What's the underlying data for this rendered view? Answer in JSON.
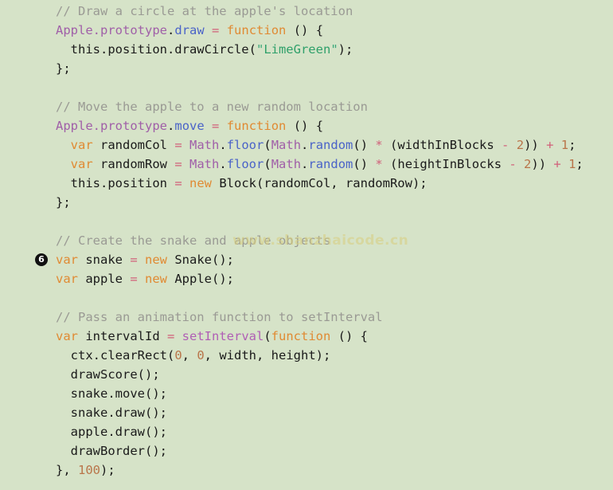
{
  "editor": {
    "background_color": "#d6e3c8",
    "font_size_px": 15.5,
    "line_height_px": 24,
    "language": "JavaScript"
  },
  "watermark": {
    "text": "www.shanzhaicode.cn",
    "color": "#d8cf7e"
  },
  "step_marker": {
    "label": "6",
    "line_index": 12,
    "background_color": "#111111",
    "text_color": "#ffffff"
  },
  "palette": {
    "comment": "#9a9a94",
    "class": "#a05fa8",
    "property": "#4a63c8",
    "operator": "#d1607a",
    "keyword": "#e08a33",
    "string": "#2fa06a",
    "function": "#b05fb5",
    "number": "#b9754a",
    "plain": "#1a1a1a"
  },
  "lines": [
    {
      "id": "line-1",
      "tokens": [
        {
          "t": "comment",
          "v": "// Draw a circle at the apple's location"
        }
      ]
    },
    {
      "id": "line-2",
      "tokens": [
        {
          "t": "class",
          "v": "Apple"
        },
        {
          "t": "class",
          "v": "."
        },
        {
          "t": "class",
          "v": "prototype"
        },
        {
          "t": "plain",
          "v": "."
        },
        {
          "t": "prop",
          "v": "draw"
        },
        {
          "t": "plain",
          "v": " "
        },
        {
          "t": "op",
          "v": "="
        },
        {
          "t": "plain",
          "v": " "
        },
        {
          "t": "keyword",
          "v": "function"
        },
        {
          "t": "plain",
          "v": " () {"
        }
      ]
    },
    {
      "id": "line-3",
      "tokens": [
        {
          "t": "plain",
          "v": "  this.position.drawCircle("
        },
        {
          "t": "quote",
          "v": "\""
        },
        {
          "t": "string",
          "v": "LimeGreen"
        },
        {
          "t": "quote",
          "v": "\""
        },
        {
          "t": "plain",
          "v": ");"
        }
      ]
    },
    {
      "id": "line-4",
      "tokens": [
        {
          "t": "plain",
          "v": "};"
        }
      ]
    },
    {
      "id": "line-5",
      "tokens": []
    },
    {
      "id": "line-6",
      "tokens": [
        {
          "t": "comment",
          "v": "// Move the apple to a new random location"
        }
      ]
    },
    {
      "id": "line-7",
      "tokens": [
        {
          "t": "class",
          "v": "Apple"
        },
        {
          "t": "class",
          "v": "."
        },
        {
          "t": "class",
          "v": "prototype"
        },
        {
          "t": "plain",
          "v": "."
        },
        {
          "t": "prop",
          "v": "move"
        },
        {
          "t": "plain",
          "v": " "
        },
        {
          "t": "op",
          "v": "="
        },
        {
          "t": "plain",
          "v": " "
        },
        {
          "t": "keyword",
          "v": "function"
        },
        {
          "t": "plain",
          "v": " () {"
        }
      ]
    },
    {
      "id": "line-8",
      "tokens": [
        {
          "t": "plain",
          "v": "  "
        },
        {
          "t": "keyword",
          "v": "var"
        },
        {
          "t": "plain",
          "v": " randomCol "
        },
        {
          "t": "op",
          "v": "="
        },
        {
          "t": "plain",
          "v": " "
        },
        {
          "t": "class",
          "v": "Math"
        },
        {
          "t": "plain",
          "v": "."
        },
        {
          "t": "prop",
          "v": "floor"
        },
        {
          "t": "plain",
          "v": "("
        },
        {
          "t": "class",
          "v": "Math"
        },
        {
          "t": "plain",
          "v": "."
        },
        {
          "t": "prop",
          "v": "random"
        },
        {
          "t": "plain",
          "v": "() "
        },
        {
          "t": "op",
          "v": "*"
        },
        {
          "t": "plain",
          "v": " (widthInBlocks "
        },
        {
          "t": "op",
          "v": "-"
        },
        {
          "t": "plain",
          "v": " "
        },
        {
          "t": "number",
          "v": "2"
        },
        {
          "t": "plain",
          "v": ")) "
        },
        {
          "t": "op",
          "v": "+"
        },
        {
          "t": "plain",
          "v": " "
        },
        {
          "t": "number",
          "v": "1"
        },
        {
          "t": "plain",
          "v": ";"
        }
      ]
    },
    {
      "id": "line-9",
      "tokens": [
        {
          "t": "plain",
          "v": "  "
        },
        {
          "t": "keyword",
          "v": "var"
        },
        {
          "t": "plain",
          "v": " randomRow "
        },
        {
          "t": "op",
          "v": "="
        },
        {
          "t": "plain",
          "v": " "
        },
        {
          "t": "class",
          "v": "Math"
        },
        {
          "t": "plain",
          "v": "."
        },
        {
          "t": "prop",
          "v": "floor"
        },
        {
          "t": "plain",
          "v": "("
        },
        {
          "t": "class",
          "v": "Math"
        },
        {
          "t": "plain",
          "v": "."
        },
        {
          "t": "prop",
          "v": "random"
        },
        {
          "t": "plain",
          "v": "() "
        },
        {
          "t": "op",
          "v": "*"
        },
        {
          "t": "plain",
          "v": " (heightInBlocks "
        },
        {
          "t": "op",
          "v": "-"
        },
        {
          "t": "plain",
          "v": " "
        },
        {
          "t": "number",
          "v": "2"
        },
        {
          "t": "plain",
          "v": ")) "
        },
        {
          "t": "op",
          "v": "+"
        },
        {
          "t": "plain",
          "v": " "
        },
        {
          "t": "number",
          "v": "1"
        },
        {
          "t": "plain",
          "v": ";"
        }
      ]
    },
    {
      "id": "line-10",
      "tokens": [
        {
          "t": "plain",
          "v": "  this.position "
        },
        {
          "t": "op",
          "v": "="
        },
        {
          "t": "plain",
          "v": " "
        },
        {
          "t": "keyword",
          "v": "new"
        },
        {
          "t": "plain",
          "v": " Block(randomCol, randomRow);"
        }
      ]
    },
    {
      "id": "line-11",
      "tokens": [
        {
          "t": "plain",
          "v": "};"
        }
      ]
    },
    {
      "id": "line-12",
      "tokens": []
    },
    {
      "id": "line-13",
      "tokens": [
        {
          "t": "comment",
          "v": "// Create the snake and apple objects"
        }
      ]
    },
    {
      "id": "line-14",
      "tokens": [
        {
          "t": "keyword",
          "v": "var"
        },
        {
          "t": "plain",
          "v": " snake "
        },
        {
          "t": "op",
          "v": "="
        },
        {
          "t": "plain",
          "v": " "
        },
        {
          "t": "keyword",
          "v": "new"
        },
        {
          "t": "plain",
          "v": " Snake();"
        }
      ]
    },
    {
      "id": "line-15",
      "tokens": [
        {
          "t": "keyword",
          "v": "var"
        },
        {
          "t": "plain",
          "v": " apple "
        },
        {
          "t": "op",
          "v": "="
        },
        {
          "t": "plain",
          "v": " "
        },
        {
          "t": "keyword",
          "v": "new"
        },
        {
          "t": "plain",
          "v": " Apple();"
        }
      ]
    },
    {
      "id": "line-16",
      "tokens": []
    },
    {
      "id": "line-17",
      "tokens": [
        {
          "t": "comment",
          "v": "// Pass an animation function to setInterval"
        }
      ]
    },
    {
      "id": "line-18",
      "tokens": [
        {
          "t": "keyword",
          "v": "var"
        },
        {
          "t": "plain",
          "v": " intervalId "
        },
        {
          "t": "op",
          "v": "="
        },
        {
          "t": "plain",
          "v": " "
        },
        {
          "t": "func",
          "v": "setInterval"
        },
        {
          "t": "plain",
          "v": "("
        },
        {
          "t": "keyword",
          "v": "function"
        },
        {
          "t": "plain",
          "v": " () {"
        }
      ]
    },
    {
      "id": "line-19",
      "tokens": [
        {
          "t": "plain",
          "v": "  ctx.clearRect("
        },
        {
          "t": "number",
          "v": "0"
        },
        {
          "t": "plain",
          "v": ", "
        },
        {
          "t": "number",
          "v": "0"
        },
        {
          "t": "plain",
          "v": ", width, height);"
        }
      ]
    },
    {
      "id": "line-20",
      "tokens": [
        {
          "t": "plain",
          "v": "  drawScore();"
        }
      ]
    },
    {
      "id": "line-21",
      "tokens": [
        {
          "t": "plain",
          "v": "  snake.move();"
        }
      ]
    },
    {
      "id": "line-22",
      "tokens": [
        {
          "t": "plain",
          "v": "  snake.draw();"
        }
      ]
    },
    {
      "id": "line-23",
      "tokens": [
        {
          "t": "plain",
          "v": "  apple.draw();"
        }
      ]
    },
    {
      "id": "line-24",
      "tokens": [
        {
          "t": "plain",
          "v": "  drawBorder();"
        }
      ]
    },
    {
      "id": "line-25",
      "tokens": [
        {
          "t": "plain",
          "v": "}, "
        },
        {
          "t": "number",
          "v": "100"
        },
        {
          "t": "plain",
          "v": ");"
        }
      ]
    }
  ]
}
